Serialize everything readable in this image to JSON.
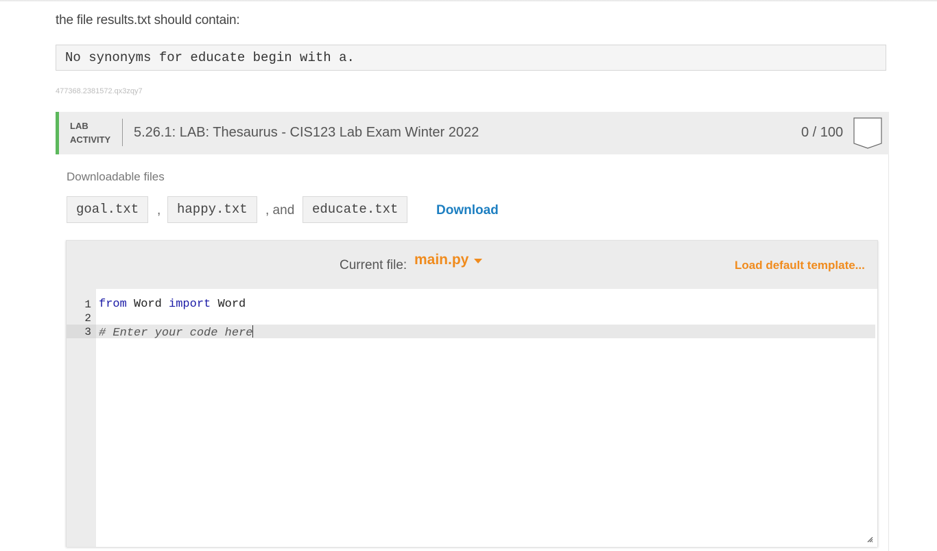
{
  "intro": {
    "text": "the file results.txt should contain:"
  },
  "expected_output": "No synonyms for educate begin with a.",
  "activity_id": "477368.2381572.qx3zqy7",
  "lab": {
    "tag_line1": "LAB",
    "tag_line2": "ACTIVITY",
    "title": "5.26.1: LAB: Thesaurus - CIS123 Lab Exam Winter 2022",
    "score": "0 / 100",
    "accent_color": "#5cb85c"
  },
  "downloads": {
    "label": "Downloadable files",
    "files": [
      "goal.txt",
      "happy.txt",
      "educate.txt"
    ],
    "separator_1": ",",
    "separator_2": ", and",
    "download_label": "Download",
    "link_color": "#1d7fc1"
  },
  "editor": {
    "current_file_label": "Current file:",
    "current_file": "main.py",
    "load_template_label": "Load default template...",
    "accent_color": "#f08b1d",
    "lines": [
      {
        "number": "1",
        "tokens": [
          "from",
          " Word ",
          "import",
          " Word"
        ]
      },
      {
        "number": "2",
        "tokens": []
      },
      {
        "number": "3",
        "tokens": [
          "# Enter your code here"
        ]
      }
    ],
    "icons": {
      "dropdown": "chevron-down-icon",
      "resize": "resize-handle-icon",
      "score_badge": "score-badge-icon"
    }
  }
}
